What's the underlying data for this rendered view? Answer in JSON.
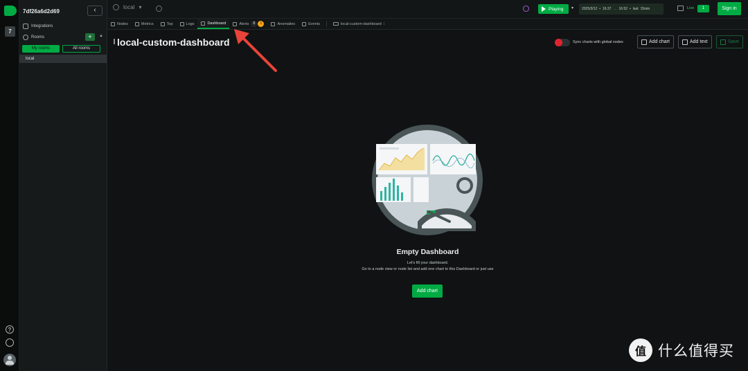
{
  "rail": {
    "space_initial": "7",
    "help_glyph": "?",
    "icons": [
      "logo-icon",
      "help-icon",
      "settings-icon",
      "user-avatar-icon"
    ]
  },
  "sidebar": {
    "space_name": "7df26a6d2d69",
    "collapse_glyph": "‹",
    "integrations_label": "Integrations",
    "rooms_label": "Rooms",
    "add_glyph": "+",
    "caret_glyph": "▲",
    "room_tabs": {
      "my_rooms": "My rooms",
      "all_rooms": "All rooms"
    },
    "rooms": [
      "local"
    ]
  },
  "topbar": {
    "room_name": "local",
    "room_caret": "▾",
    "playing_label": "Playing",
    "play_caret": "▾",
    "time": {
      "date": "2025/3/12",
      "sep1": "•",
      "start": "16:37",
      "arrow": "→",
      "end": "16:52",
      "sep2": "•",
      "last_label": "last",
      "range": "15min"
    },
    "live_label": "Live",
    "live_count": "1",
    "signin_label": "Sign in"
  },
  "tabs": {
    "items": [
      {
        "label": "Nodes",
        "icon": "nodes-icon"
      },
      {
        "label": "Metrics",
        "icon": "metrics-icon"
      },
      {
        "label": "Top",
        "icon": "top-icon"
      },
      {
        "label": "Logs",
        "icon": "logs-icon"
      },
      {
        "label": "Dashboard",
        "icon": "dashboard-icon",
        "active": true
      },
      {
        "label": "Alerts",
        "icon": "bell-icon",
        "badge_critical": "0",
        "badge_warning": "1"
      },
      {
        "label": "Anomalies",
        "icon": "anomalies-icon"
      },
      {
        "label": "Events",
        "icon": "events-icon"
      },
      {
        "label": "local-custom-dashboard",
        "icon": "dashboard-file-icon"
      }
    ],
    "more_glyph": "⁝"
  },
  "main": {
    "title": "local-custom-dashboard",
    "sync_label": "Sync charts with global nodes",
    "add_chart_label": "Add chart",
    "add_text_label": "Add text",
    "save_label": "Save",
    "empty_title": "Empty Dashboard",
    "empty_line1": "Let's fill your dashboard.",
    "empty_line2": "Go to a node view or node list and add one chart to this Dashboard or just use",
    "empty_add_chart_label": "Add chart"
  },
  "colors": {
    "accent": "#00ab44",
    "alert_red": "#e0242f",
    "warning_orange": "#f7a51b",
    "annotation_arrow": "#e8443a"
  },
  "watermark": {
    "glyph": "值",
    "text": "什么值得买"
  }
}
